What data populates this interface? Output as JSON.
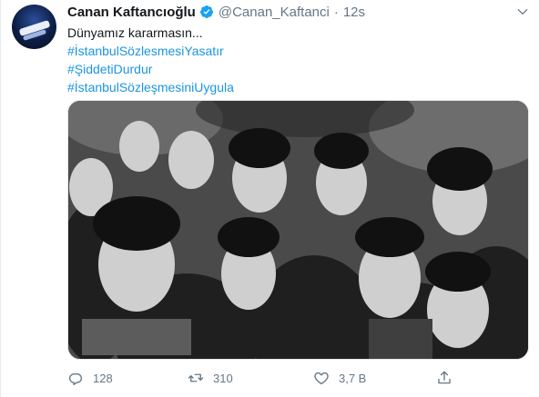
{
  "author": {
    "name": "Canan Kaftancıoğlu",
    "handle": "@Canan_Kaftanci",
    "time": "12s",
    "separator": "·"
  },
  "tweet": {
    "lines": [
      {
        "text": "Dünyamız kararmasın...",
        "hashtag": false
      },
      {
        "text": "#İstanbulSözlesmesiYasatır",
        "hashtag": true
      },
      {
        "text": "#ŞiddetiDurdur",
        "hashtag": true
      },
      {
        "text": "#İstanbulSözleşmesiniUygula",
        "hashtag": true
      }
    ]
  },
  "actions": {
    "reply_count": "128",
    "retweet_count": "310",
    "like_count": "3,7 B"
  },
  "colors": {
    "accent": "#1b95e0",
    "verified": "#1da1f2",
    "muted": "#657786",
    "text": "#14171a"
  },
  "icons": {
    "verified": "verified-badge-icon",
    "caret": "chevron-down-icon",
    "reply": "reply-icon",
    "retweet": "retweet-icon",
    "like": "heart-icon",
    "share": "share-icon"
  }
}
